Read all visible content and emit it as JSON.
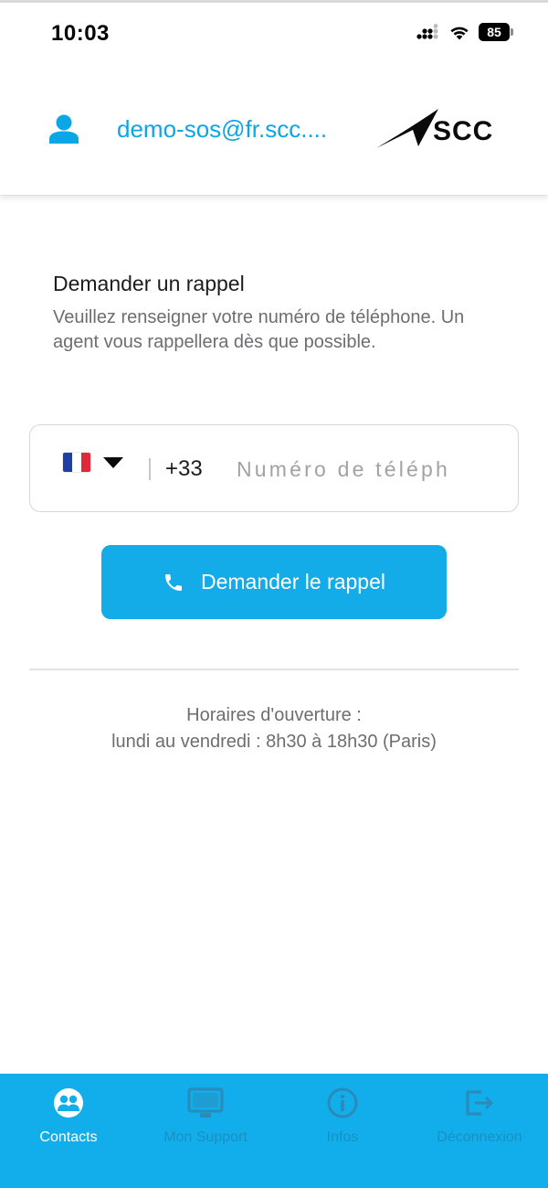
{
  "status_bar": {
    "time": "10:03",
    "battery": "85"
  },
  "header": {
    "email": "demo-sos@fr.scc....",
    "logo_text": "SCC"
  },
  "callback": {
    "title": "Demander un rappel",
    "description": "Veuillez renseigner votre numéro de téléphone. Un agent vous rappellera dès que possible.",
    "country_flag": "france-flag",
    "dial_code": "+33",
    "phone_placeholder": "Numéro de téléph",
    "phone_value": "",
    "submit_label": "Demander le rappel"
  },
  "opening_hours": {
    "line1": "Horaires d'ouverture :",
    "line2": "lundi au vendredi : 8h30 à 18h30 (Paris)"
  },
  "tab_bar": {
    "tabs": [
      {
        "label": "Contacts",
        "icon": "contacts-icon",
        "active": true
      },
      {
        "label": "Mon Support",
        "icon": "monitor-icon",
        "active": false
      },
      {
        "label": "Infos",
        "icon": "info-icon",
        "active": false
      },
      {
        "label": "Déconnexion",
        "icon": "logout-icon",
        "active": false
      }
    ]
  },
  "colors": {
    "accent": "#13abe8",
    "email": "#0ba6e6",
    "tab_bar": "#12aeeb"
  }
}
